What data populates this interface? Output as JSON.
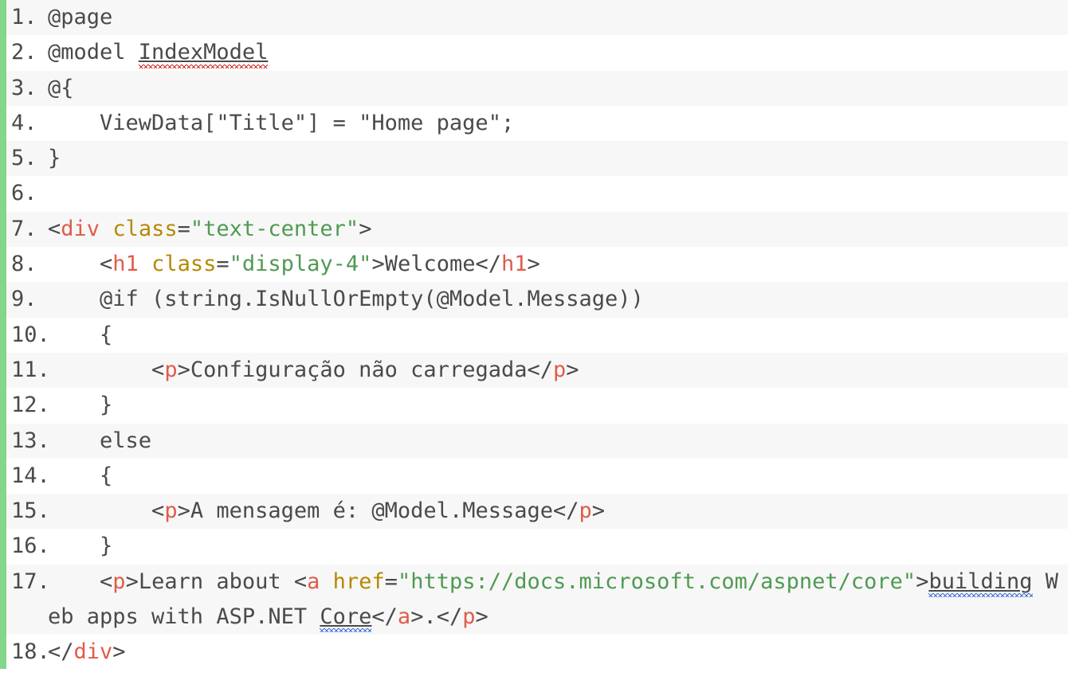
{
  "editor": {
    "language": "razor-cshtml",
    "accent_bar_color": "#84d68a",
    "stripe_color": "#f7f7f7",
    "background_color": "#ffffff",
    "text_color": "#4a4a4a",
    "tag_color": "#e05c4a",
    "attribute_color": "#b58900",
    "value_color": "#4f9a52",
    "spellcheck_error_color": "#d32f2f",
    "grammar_warning_color": "#3d73d9",
    "total_lines": 18
  },
  "lines": [
    {
      "number": "1.",
      "text": "@page",
      "tokens": [
        {
          "t": "@page",
          "c": "tok-plain"
        }
      ]
    },
    {
      "number": "2.",
      "text": "@model IndexModel",
      "tokens": [
        {
          "t": "@model ",
          "c": "tok-plain"
        },
        {
          "t": "IndexModel",
          "c": "tok-plain",
          "mark": "spell-error"
        }
      ]
    },
    {
      "number": "3.",
      "text": "@{",
      "tokens": [
        {
          "t": "@{",
          "c": "tok-plain"
        }
      ]
    },
    {
      "number": "4.",
      "text": "    ViewData[\"Title\"] = \"Home page\";",
      "tokens": [
        {
          "t": "    ViewData[\"Title\"] = \"Home page\";",
          "c": "tok-plain"
        }
      ]
    },
    {
      "number": "5.",
      "text": "}",
      "tokens": [
        {
          "t": "}",
          "c": "tok-plain"
        }
      ]
    },
    {
      "number": "6.",
      "text": "",
      "tokens": []
    },
    {
      "number": "7.",
      "text": "<div class=\"text-center\">",
      "tokens": [
        {
          "t": "<",
          "c": "tok-punct"
        },
        {
          "t": "div",
          "c": "tok-tag"
        },
        {
          "t": " ",
          "c": "tok-plain"
        },
        {
          "t": "class",
          "c": "tok-attr"
        },
        {
          "t": "=",
          "c": "tok-punct"
        },
        {
          "t": "\"text-center\"",
          "c": "tok-value"
        },
        {
          "t": ">",
          "c": "tok-punct"
        }
      ]
    },
    {
      "number": "8.",
      "text": "    <h1 class=\"display-4\">Welcome</h1>",
      "tokens": [
        {
          "t": "    <",
          "c": "tok-punct"
        },
        {
          "t": "h1",
          "c": "tok-tag"
        },
        {
          "t": " ",
          "c": "tok-plain"
        },
        {
          "t": "class",
          "c": "tok-attr"
        },
        {
          "t": "=",
          "c": "tok-punct"
        },
        {
          "t": "\"display-4\"",
          "c": "tok-value"
        },
        {
          "t": ">Welcome</",
          "c": "tok-punct"
        },
        {
          "t": "h1",
          "c": "tok-tag"
        },
        {
          "t": ">",
          "c": "tok-punct"
        }
      ]
    },
    {
      "number": "9.",
      "text": "    @if (string.IsNullOrEmpty(@Model.Message))",
      "tokens": [
        {
          "t": "    @if (string.IsNullOrEmpty(@Model.Message))",
          "c": "tok-plain"
        }
      ]
    },
    {
      "number": "10.",
      "text": "    {",
      "tokens": [
        {
          "t": "    {",
          "c": "tok-plain"
        }
      ]
    },
    {
      "number": "11.",
      "text": "        <p>Configuração não carregada</p>",
      "tokens": [
        {
          "t": "        <",
          "c": "tok-punct"
        },
        {
          "t": "p",
          "c": "tok-tag"
        },
        {
          "t": ">Configuração não carregada</",
          "c": "tok-punct"
        },
        {
          "t": "p",
          "c": "tok-tag"
        },
        {
          "t": ">",
          "c": "tok-punct"
        }
      ]
    },
    {
      "number": "12.",
      "text": "    }",
      "tokens": [
        {
          "t": "    }",
          "c": "tok-plain"
        }
      ]
    },
    {
      "number": "13.",
      "text": "    else",
      "tokens": [
        {
          "t": "    else",
          "c": "tok-plain"
        }
      ]
    },
    {
      "number": "14.",
      "text": "    {",
      "tokens": [
        {
          "t": "    {",
          "c": "tok-plain"
        }
      ]
    },
    {
      "number": "15.",
      "text": "        <p>A mensagem é: @Model.Message</p>",
      "tokens": [
        {
          "t": "        <",
          "c": "tok-punct"
        },
        {
          "t": "p",
          "c": "tok-tag"
        },
        {
          "t": ">A mensagem é: @Model.Message</",
          "c": "tok-punct"
        },
        {
          "t": "p",
          "c": "tok-tag"
        },
        {
          "t": ">",
          "c": "tok-punct"
        }
      ]
    },
    {
      "number": "16.",
      "text": "    }",
      "tokens": [
        {
          "t": "    }",
          "c": "tok-plain"
        }
      ]
    },
    {
      "number": "17.",
      "text": "    <p>Learn about <a href=\"https://docs.microsoft.com/aspnet/core\">building Web apps with ASP.NET Core</a>.</p>",
      "wrapped": true,
      "tokens": [
        {
          "t": "    <",
          "c": "tok-punct"
        },
        {
          "t": "p",
          "c": "tok-tag"
        },
        {
          "t": ">Learn about <",
          "c": "tok-punct"
        },
        {
          "t": "a",
          "c": "tok-tag"
        },
        {
          "t": " ",
          "c": "tok-plain"
        },
        {
          "t": "href",
          "c": "tok-attr"
        },
        {
          "t": "=",
          "c": "tok-punct"
        },
        {
          "t": "\"https://docs.microsoft.com/aspnet/core\"",
          "c": "tok-value"
        },
        {
          "t": ">",
          "c": "tok-punct"
        },
        {
          "t": "building",
          "c": "tok-punct",
          "mark": "grammar-warning"
        },
        {
          "t": " Web apps with ASP.NET ",
          "c": "tok-punct"
        },
        {
          "t": "Core",
          "c": "tok-punct",
          "mark": "grammar-warning"
        },
        {
          "t": "</",
          "c": "tok-punct"
        },
        {
          "t": "a",
          "c": "tok-tag"
        },
        {
          "t": ">.</",
          "c": "tok-punct"
        },
        {
          "t": "p",
          "c": "tok-tag"
        },
        {
          "t": ">",
          "c": "tok-punct"
        }
      ]
    },
    {
      "number": "18.",
      "text": "</div>",
      "tokens": [
        {
          "t": "</",
          "c": "tok-punct"
        },
        {
          "t": "div",
          "c": "tok-tag"
        },
        {
          "t": ">",
          "c": "tok-punct"
        }
      ]
    }
  ]
}
